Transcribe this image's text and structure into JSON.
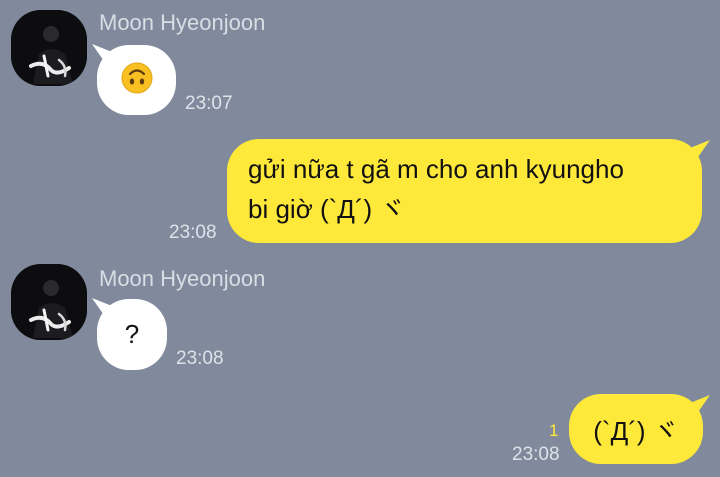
{
  "messages": [
    {
      "direction": "incoming",
      "sender": "Moon Hyeonjoon",
      "type": "emoji",
      "emoji": "upside-down-face",
      "time": "23:07"
    },
    {
      "direction": "outgoing",
      "text": "gửi nữa t gã m cho anh kyungho\nbi giờ (`Д´) ヾ",
      "time": "23:08"
    },
    {
      "direction": "incoming",
      "sender": "Moon Hyeonjoon",
      "type": "text",
      "text": "?",
      "time": "23:08"
    },
    {
      "direction": "outgoing",
      "text": "(`Д´) ヾ",
      "time": "23:08",
      "unread": "1"
    }
  ],
  "colors": {
    "background": "#808a9c",
    "incoming_bubble": "#ffffff",
    "outgoing_bubble": "#fee83a",
    "emoji_face": "#f8c020",
    "unread": "#fee83a"
  }
}
